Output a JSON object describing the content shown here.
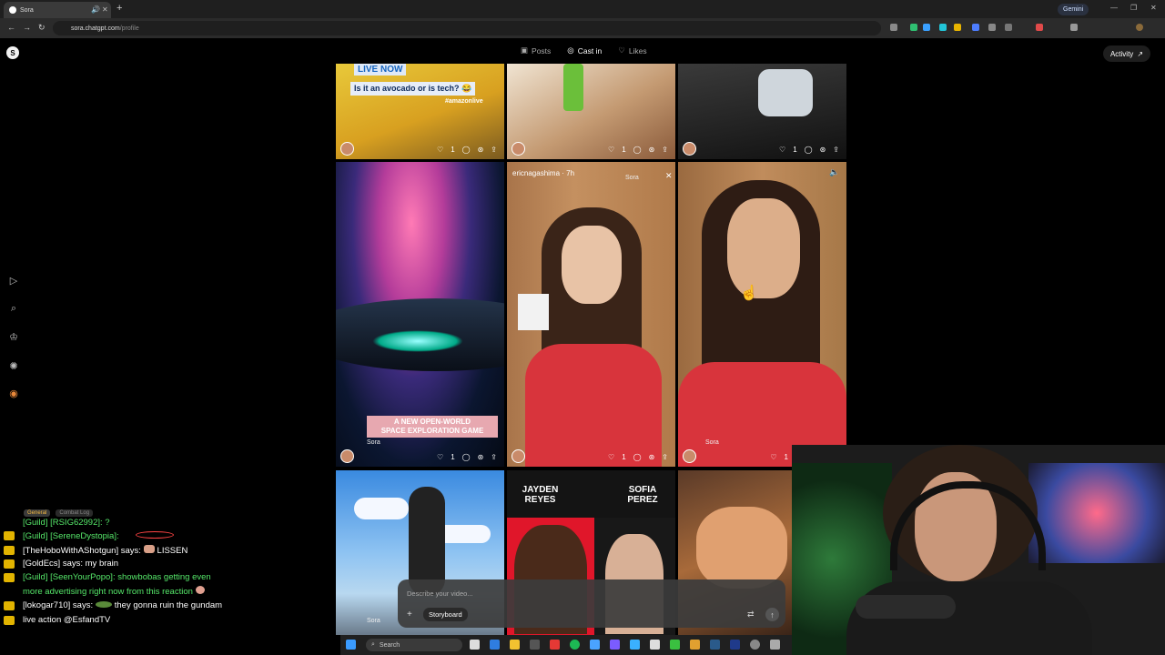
{
  "browser": {
    "tab_title": "Sora",
    "url_host": "sora.chatgpt.com",
    "url_path": "/profile",
    "gemini_label": "Gemini"
  },
  "profile_tabs": {
    "posts": "Posts",
    "cast_in": "Cast in",
    "likes": "Likes"
  },
  "activity_label": "Activity",
  "tiles": {
    "live_badge": "LIVE NOW",
    "avocado_caption": "Is it an avocado or is tech? 😂",
    "amazon_tag": "#amazonlive",
    "game_caption_line1": "A NEW OPEN-WORLD",
    "game_caption_line2": "SPACE EXPLORATION GAME",
    "poster_user": "ericnagashima",
    "poster_time": "7h",
    "sora_label": "Sora",
    "name_left_1": "JAYDEN",
    "name_left_2": "REYES",
    "name_right_1": "SOFIA",
    "name_right_2": "PEREZ",
    "like_count": "1"
  },
  "prompt": {
    "placeholder": "Describe your video...",
    "storyboard": "Storyboard"
  },
  "chat": {
    "tab_general": "General",
    "tab_combat": "Combat Log",
    "lines": [
      {
        "prefix": "[Guild] [RSIG62992]: ",
        "text": "?"
      },
      {
        "prefix": "[Guild] [SereneDystopia]: ",
        "text": ""
      },
      {
        "prefix": "[TheHoboWithAShotgun] says: ",
        "text": "LISSEN"
      },
      {
        "prefix": "[GoldEcs] says: ",
        "text": "my brain"
      },
      {
        "prefix": "[Guild] [SeenYourPopo]: ",
        "text": "showbobas getting even"
      },
      {
        "prefix": "",
        "text": "more advertising right now from this reaction"
      },
      {
        "prefix": "[lokogar710] says: ",
        "text": "they gonna ruin the gundam"
      },
      {
        "prefix": "",
        "text": "live action @EsfandTV"
      }
    ]
  },
  "taskbar": {
    "search_label": "Search"
  }
}
